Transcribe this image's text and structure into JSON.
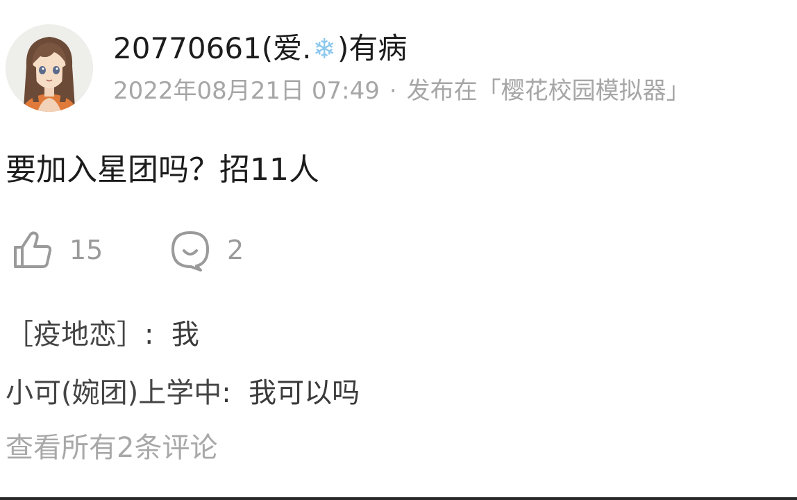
{
  "post": {
    "author": {
      "name_prefix": "20770661(爱.",
      "name_emoji": "❄",
      "name_suffix": ")有病",
      "avatar": "anime-girl-avatar"
    },
    "timestamp": "2022年08月21日 07:49",
    "separator": "·",
    "published_in": "发布在「樱花校园模拟器」",
    "content": "要加入星团吗？招11人",
    "likes": "15",
    "comment_count": "2",
    "icons": {
      "like": "thumbs-up-icon",
      "comment": "comment-bubble-icon"
    }
  },
  "comments": [
    {
      "author": "［疫地恋］",
      "separator": ":",
      "text": "我"
    },
    {
      "author": "小可(婉团)上学中",
      "separator": ":",
      "text": "我可以吗"
    }
  ],
  "view_all_comments": "查看所有2条评论",
  "colors": {
    "primary_text": "#1c1c1c",
    "secondary_text": "#a6a6a6",
    "icon": "#9a9a9a",
    "snowflake": "#8cc8ee"
  }
}
